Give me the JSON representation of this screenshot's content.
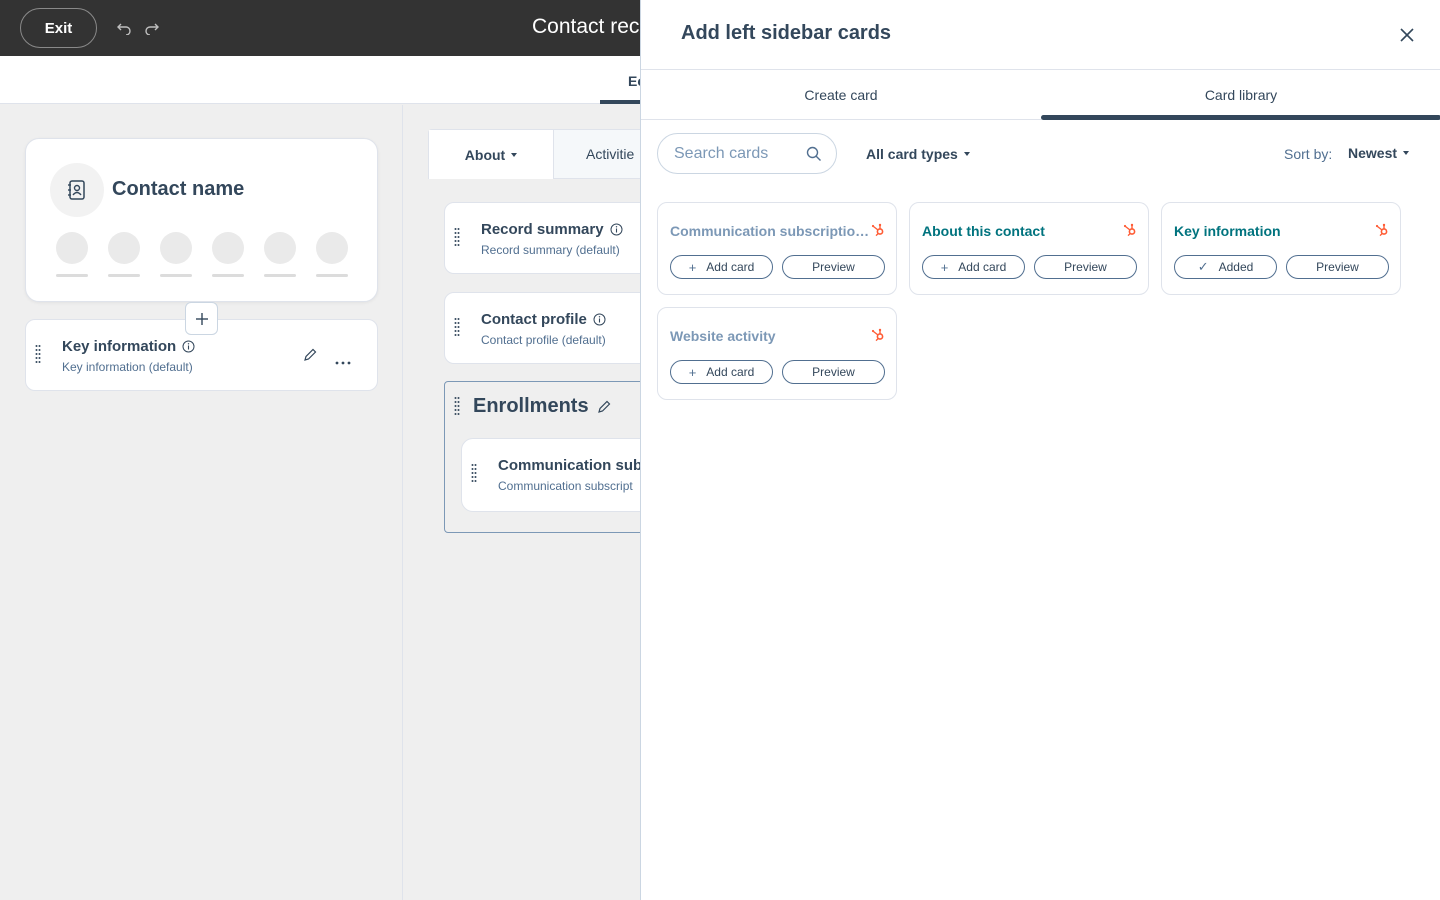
{
  "topbar": {
    "exit_label": "Exit",
    "title": "Contact rec"
  },
  "subheader": {
    "active_tab": "Ec"
  },
  "contact_card": {
    "name": "Contact name"
  },
  "left_cards": [
    {
      "title": "Key information",
      "subtitle": "Key information (default)"
    }
  ],
  "middle": {
    "tabs": {
      "about": "About",
      "activities": "Activitie"
    },
    "cards": [
      {
        "title": "Record summary",
        "subtitle": "Record summary (default)"
      },
      {
        "title": "Contact profile",
        "subtitle": "Contact profile (default)"
      }
    ],
    "group": {
      "title": "Enrollments",
      "card": {
        "title": "Communication subs",
        "subtitle": "Communication subscript"
      }
    }
  },
  "panel": {
    "title": "Add left sidebar cards",
    "tabs": {
      "create": "Create card",
      "library": "Card library"
    },
    "search_placeholder": "Search cards",
    "card_types": "All card types",
    "sort_label": "Sort by:",
    "sort_value": "Newest",
    "cards": [
      {
        "name": "Communication subscriptio…",
        "action": "Add card",
        "preview": "Preview"
      },
      {
        "name": "About this contact",
        "action": "Add card",
        "preview": "Preview"
      },
      {
        "name": "Key information",
        "action": "Added",
        "preview": "Preview"
      },
      {
        "name": "Website activity",
        "action": "Add card",
        "preview": "Preview"
      }
    ]
  },
  "colors": {
    "topbar": "#333333",
    "teal": "#00737e",
    "hubspot_orange": "#ff5c35",
    "text": "#33475b"
  }
}
